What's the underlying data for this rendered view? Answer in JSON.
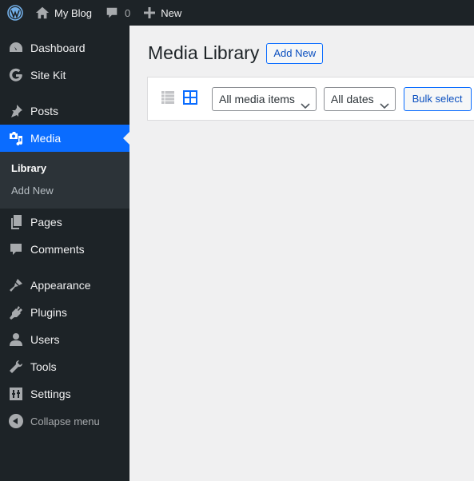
{
  "adminbar": {
    "site_name": "My Blog",
    "comments_count": "0",
    "new_label": "New"
  },
  "sidebar": {
    "items": [
      {
        "label": "Dashboard",
        "icon": "dashboard-icon"
      },
      {
        "label": "Site Kit",
        "icon": "google-g-icon"
      },
      {
        "label": "Posts",
        "icon": "pushpin-icon"
      },
      {
        "label": "Media",
        "icon": "media-icon",
        "current": true
      },
      {
        "label": "Pages",
        "icon": "pages-icon"
      },
      {
        "label": "Comments",
        "icon": "comment-icon"
      },
      {
        "label": "Appearance",
        "icon": "paintbrush-icon"
      },
      {
        "label": "Plugins",
        "icon": "plugin-icon"
      },
      {
        "label": "Users",
        "icon": "user-icon"
      },
      {
        "label": "Tools",
        "icon": "wrench-icon"
      },
      {
        "label": "Settings",
        "icon": "settings-icon"
      }
    ],
    "media_submenu": [
      {
        "label": "Library",
        "current": true
      },
      {
        "label": "Add New"
      }
    ],
    "collapse_label": "Collapse menu"
  },
  "main": {
    "title": "Media Library",
    "add_new_label": "Add New",
    "toolbar": {
      "view_modes": [
        "list",
        "grid"
      ],
      "active_view": "grid",
      "type_filter": "All media items",
      "date_filter": "All dates",
      "bulk_select_label": "Bulk select"
    }
  },
  "colors": {
    "adminbar_bg": "#1d2327",
    "sidebar_bg": "#1d2327",
    "submenu_bg": "#2c3338",
    "accent": "#0a6cff",
    "content_bg": "#f0f0f1"
  }
}
